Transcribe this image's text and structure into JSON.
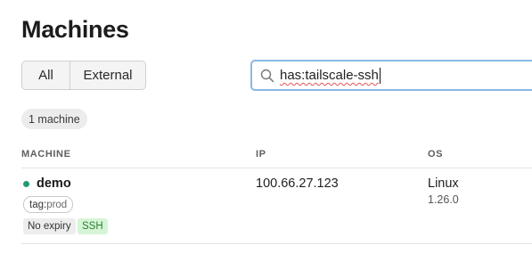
{
  "page": {
    "title": "Machines"
  },
  "filters": {
    "all_label": "All",
    "external_label": "External"
  },
  "search": {
    "value": "has:tailscale-ssh",
    "icon": "search-icon"
  },
  "count_badge": "1 machine",
  "table": {
    "columns": [
      "MACHINE",
      "IP",
      "OS"
    ],
    "rows": [
      {
        "name": "demo",
        "status_color": "#1f9d6b",
        "tag_key": "tag:",
        "tag_value": "prod",
        "badges": [
          "No expiry",
          "SSH"
        ],
        "ip": "100.66.27.123",
        "os": "Linux",
        "os_version": "1.26.0"
      }
    ]
  },
  "colors": {
    "accent_focus": "#8ab8e6",
    "online": "#1f9d6b",
    "ssh_bg": "#d6f5d6",
    "ssh_text": "#2e7d32"
  }
}
